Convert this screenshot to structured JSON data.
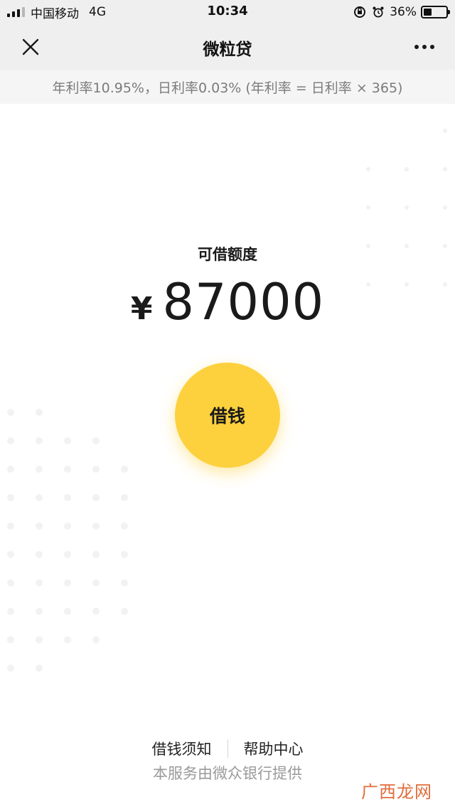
{
  "status_bar": {
    "carrier": "中国移动",
    "network": "4G",
    "time": "10:34",
    "battery_percent_label": "36%",
    "battery_level": 0.36,
    "icons": [
      "signal-icon",
      "rotation-lock-icon",
      "alarm-icon",
      "battery-icon"
    ]
  },
  "nav": {
    "title": "微粒贷",
    "close_icon": "close-icon",
    "more_icon": "more-icon"
  },
  "rate_notice": {
    "text": "年利率10.95%，日利率0.03% (年利率 = 日利率 × 365)"
  },
  "credit": {
    "label": "可借额度",
    "currency": "¥",
    "amount": "87000"
  },
  "borrow_button": {
    "label": "借钱",
    "color": "#fdd13e"
  },
  "footer": {
    "links": [
      "借钱须知",
      "帮助中心"
    ],
    "provider": "本服务由微众银行提供"
  },
  "watermark": {
    "text": "广西龙网",
    "color": "#e26d3c"
  }
}
